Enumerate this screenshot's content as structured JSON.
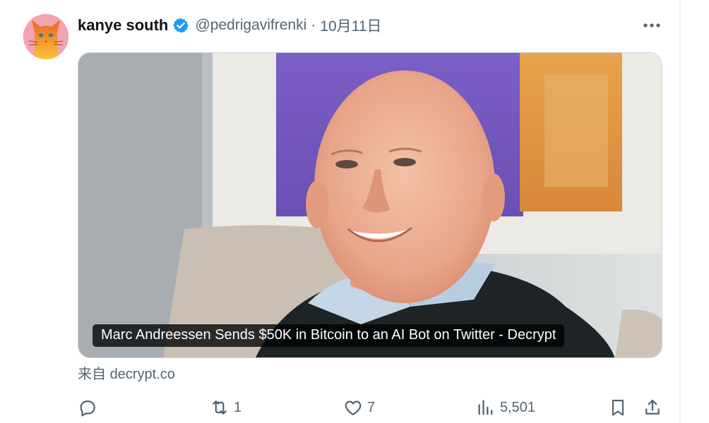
{
  "tweet": {
    "display_name": "kanye south",
    "handle": "@pedrigavifrenki",
    "separator": "·",
    "date": "10月11日",
    "verified_icon": "verified-badge-icon",
    "more_icon": "more-horizontal-icon"
  },
  "card": {
    "title": "Marc Andreessen Sends $50K in Bitcoin to an AI Bot on Twitter - Decrypt",
    "image_icon": "article-photo"
  },
  "source": {
    "prefix": "来自",
    "domain": "decrypt.co"
  },
  "actions": {
    "reply_icon": "reply-icon",
    "retweet_icon": "retweet-icon",
    "retweet_count": "1",
    "like_icon": "heart-icon",
    "like_count": "7",
    "views_icon": "views-icon",
    "views_count": "5,501",
    "bookmark_icon": "bookmark-icon",
    "share_icon": "share-icon"
  },
  "colors": {
    "text_primary": "#0f1419",
    "text_secondary": "#536471",
    "verified_blue": "#1d9bf0",
    "border": "#cfd9de"
  }
}
